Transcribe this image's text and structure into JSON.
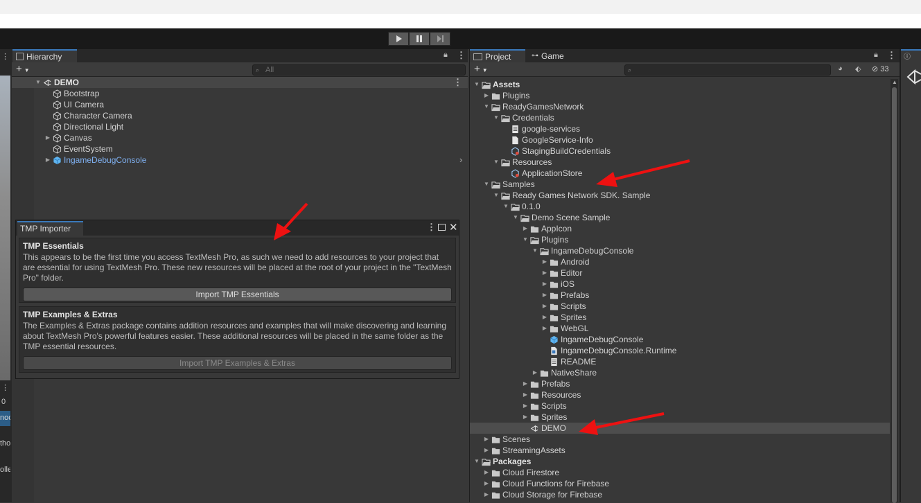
{
  "toolbar": {
    "play": "play-icon",
    "pause": "pause-icon",
    "step": "step-icon"
  },
  "left_edge": {
    "values": [
      "0",
      "noc",
      "tho",
      "olle"
    ]
  },
  "hierarchy": {
    "tab_label": "Hierarchy",
    "add_label": "+",
    "search_placeholder": "All",
    "scene_name": "DEMO",
    "items": [
      {
        "label": "Bootstrap",
        "expandable": false,
        "prefab": false
      },
      {
        "label": "UI Camera",
        "expandable": false,
        "prefab": false
      },
      {
        "label": "Character Camera",
        "expandable": false,
        "prefab": false
      },
      {
        "label": "Directional Light",
        "expandable": false,
        "prefab": false
      },
      {
        "label": "Canvas",
        "expandable": true,
        "prefab": false
      },
      {
        "label": "EventSystem",
        "expandable": false,
        "prefab": false
      },
      {
        "label": "IngameDebugConsole",
        "expandable": true,
        "prefab": true
      }
    ]
  },
  "tmp_importer": {
    "tab_label": "TMP Importer",
    "essentials_title": "TMP Essentials",
    "essentials_text": "This appears to be the first time you access TextMesh Pro, as such we need to add resources to your project that are essential for using TextMesh Pro. These new resources will be placed at the root of your project in the \"TextMesh Pro\" folder.",
    "essentials_button": "Import TMP Essentials",
    "extras_title": "TMP Examples & Extras",
    "extras_text": "The Examples & Extras package contains addition resources and examples that will make discovering and learning about TextMesh Pro's powerful features easier. These additional resources will be placed in the same folder as the TMP essential resources.",
    "extras_button": "Import TMP Examples & Extras"
  },
  "project": {
    "tab_project": "Project",
    "tab_game": "Game",
    "hidden_count": "33",
    "tree": [
      {
        "label": "Assets",
        "depth": 0,
        "arrow": "down",
        "icon": "folder-open",
        "bold": true
      },
      {
        "label": "Plugins",
        "depth": 1,
        "arrow": "right",
        "icon": "folder"
      },
      {
        "label": "ReadyGamesNetwork",
        "depth": 1,
        "arrow": "down",
        "icon": "folder-open"
      },
      {
        "label": "Credentials",
        "depth": 2,
        "arrow": "down",
        "icon": "folder-open"
      },
      {
        "label": "google-services",
        "depth": 3,
        "arrow": "none",
        "icon": "text-file"
      },
      {
        "label": "GoogleService-Info",
        "depth": 3,
        "arrow": "none",
        "icon": "file"
      },
      {
        "label": "StagingBuildCredentials",
        "depth": 3,
        "arrow": "none",
        "icon": "asset"
      },
      {
        "label": "Resources",
        "depth": 2,
        "arrow": "down",
        "icon": "folder-open"
      },
      {
        "label": "ApplicationStore",
        "depth": 3,
        "arrow": "none",
        "icon": "asset"
      },
      {
        "label": "Samples",
        "depth": 1,
        "arrow": "down",
        "icon": "folder-open"
      },
      {
        "label": "Ready Games Network SDK. Sample",
        "depth": 2,
        "arrow": "down",
        "icon": "folder-open"
      },
      {
        "label": "0.1.0",
        "depth": 3,
        "arrow": "down",
        "icon": "folder-open"
      },
      {
        "label": "Demo Scene Sample",
        "depth": 4,
        "arrow": "down",
        "icon": "folder-open"
      },
      {
        "label": "AppIcon",
        "depth": 5,
        "arrow": "right",
        "icon": "folder"
      },
      {
        "label": "Plugins",
        "depth": 5,
        "arrow": "down",
        "icon": "folder-open"
      },
      {
        "label": "IngameDebugConsole",
        "depth": 6,
        "arrow": "down",
        "icon": "folder-open"
      },
      {
        "label": "Android",
        "depth": 7,
        "arrow": "right",
        "icon": "folder"
      },
      {
        "label": "Editor",
        "depth": 7,
        "arrow": "right",
        "icon": "folder"
      },
      {
        "label": "iOS",
        "depth": 7,
        "arrow": "right",
        "icon": "folder"
      },
      {
        "label": "Prefabs",
        "depth": 7,
        "arrow": "right",
        "icon": "folder"
      },
      {
        "label": "Scripts",
        "depth": 7,
        "arrow": "right",
        "icon": "folder"
      },
      {
        "label": "Sprites",
        "depth": 7,
        "arrow": "right",
        "icon": "folder"
      },
      {
        "label": "WebGL",
        "depth": 7,
        "arrow": "right",
        "icon": "folder"
      },
      {
        "label": "IngameDebugConsole",
        "depth": 7,
        "arrow": "none",
        "icon": "prefab"
      },
      {
        "label": "IngameDebugConsole.Runtime",
        "depth": 7,
        "arrow": "none",
        "icon": "asmdef"
      },
      {
        "label": "README",
        "depth": 7,
        "arrow": "none",
        "icon": "text-file"
      },
      {
        "label": "NativeShare",
        "depth": 6,
        "arrow": "right",
        "icon": "folder"
      },
      {
        "label": "Prefabs",
        "depth": 5,
        "arrow": "right",
        "icon": "folder"
      },
      {
        "label": "Resources",
        "depth": 5,
        "arrow": "right",
        "icon": "folder"
      },
      {
        "label": "Scripts",
        "depth": 5,
        "arrow": "right",
        "icon": "folder"
      },
      {
        "label": "Sprites",
        "depth": 5,
        "arrow": "right",
        "icon": "folder"
      },
      {
        "label": "DEMO",
        "depth": 5,
        "arrow": "none",
        "icon": "scene",
        "selected": true
      },
      {
        "label": "Scenes",
        "depth": 1,
        "arrow": "right",
        "icon": "folder"
      },
      {
        "label": "StreamingAssets",
        "depth": 1,
        "arrow": "right",
        "icon": "folder"
      },
      {
        "label": "Packages",
        "depth": 0,
        "arrow": "down",
        "icon": "folder-open",
        "bold": true
      },
      {
        "label": "Cloud Firestore",
        "depth": 1,
        "arrow": "right",
        "icon": "folder"
      },
      {
        "label": "Cloud Functions for Firebase",
        "depth": 1,
        "arrow": "right",
        "icon": "folder"
      },
      {
        "label": "Cloud Storage for Firebase",
        "depth": 1,
        "arrow": "right",
        "icon": "folder"
      }
    ]
  },
  "colors": {
    "accent": "#3a79bb",
    "annotation": "#ee1111",
    "prefab": "#7fb0f0"
  }
}
